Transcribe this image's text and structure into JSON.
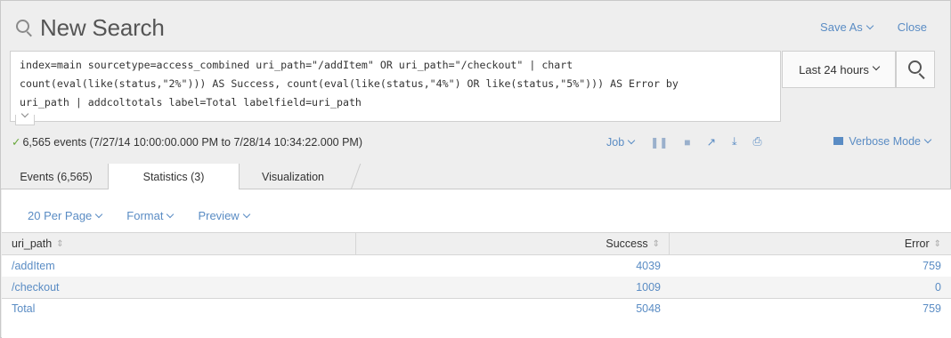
{
  "header": {
    "title": "New Search",
    "save_as": "Save As",
    "close": "Close"
  },
  "query": {
    "text": "index=main sourcetype=access_combined uri_path=\"/addItem\" OR uri_path=\"/checkout\" | chart count(eval(like(status,\"2%\"))) AS Success, count(eval(like(status,\"4%\") OR like(status,\"5%\"))) AS Error by uri_path | addcoltotals label=Total labelfield=uri_path",
    "line1": "index=main sourcetype=access_combined uri_path=\"/addItem\" OR uri_path=\"/checkout\" | chart",
    "line2": "count(eval(like(status,\"2%\"))) AS Success, count(eval(like(status,\"4%\") OR like(status,\"5%\"))) AS Error by",
    "line3": "uri_path | addcoltotals label=Total labelfield=uri_path",
    "time_range": "Last 24 hours"
  },
  "status": {
    "events_text": "6,565 events (7/27/14 10:00:00.000 PM to 7/28/14 10:34:22.000 PM)",
    "job_label": "Job",
    "mode": "Verbose Mode"
  },
  "tabs": [
    {
      "label": "Events (6,565)"
    },
    {
      "label": "Statistics (3)"
    },
    {
      "label": "Visualization"
    }
  ],
  "options": {
    "per_page": "20 Per Page",
    "format": "Format",
    "preview": "Preview"
  },
  "table": {
    "columns": [
      "uri_path",
      "Success",
      "Error"
    ],
    "rows": [
      {
        "uri_path": "/addItem",
        "Success": "4039",
        "Error": "759"
      },
      {
        "uri_path": "/checkout",
        "Success": "1009",
        "Error": "0"
      },
      {
        "uri_path": "Total",
        "Success": "5048",
        "Error": "759"
      }
    ]
  },
  "colors": {
    "link": "#5a8cc4",
    "success_check": "#65a637",
    "chrome": "#eeeeee"
  }
}
